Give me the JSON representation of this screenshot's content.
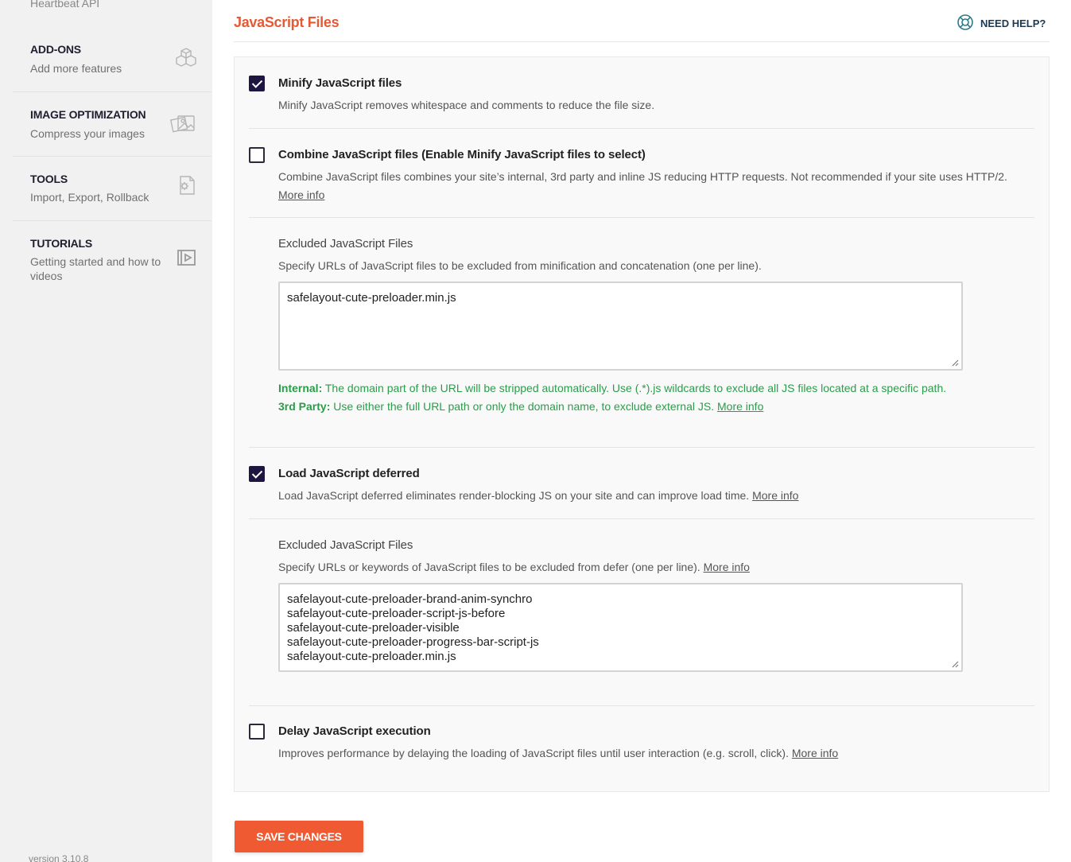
{
  "sidebar": {
    "top_item": "Heartbeat API",
    "items": [
      {
        "title": "ADD-ONS",
        "subtitle": "Add more features",
        "icon": "cubes-icon"
      },
      {
        "title": "IMAGE OPTIMIZATION",
        "subtitle": "Compress your images",
        "icon": "images-icon"
      },
      {
        "title": "TOOLS",
        "subtitle": "Import, Export, Rollback",
        "icon": "gear-file-icon"
      },
      {
        "title": "TUTORIALS",
        "subtitle": "Getting started and how to videos",
        "icon": "video-icon"
      }
    ],
    "version": "version 3.10.8"
  },
  "header": {
    "title": "JavaScript Files",
    "help_label": "NEED HELP?"
  },
  "options": {
    "minify": {
      "checked": true,
      "title": "Minify JavaScript files",
      "desc": "Minify JavaScript removes whitespace and comments to reduce the file size."
    },
    "combine": {
      "checked": false,
      "title": "Combine JavaScript files (Enable Minify JavaScript files to select)",
      "desc": "Combine JavaScript files combines your site’s internal, 3rd party and inline JS reducing HTTP requests. Not recommended if your site uses HTTP/2.",
      "link": "More info"
    },
    "excluded_minify": {
      "title": "Excluded JavaScript Files",
      "desc": "Specify URLs of JavaScript files to be excluded from minification and concatenation (one per line).",
      "value": "safelayout-cute-preloader.min.js",
      "note_internal_label": "Internal:",
      "note_internal_text": " The domain part of the URL will be stripped automatically. Use (.*).js wildcards to exclude all JS files located at a specific path.",
      "note_3rd_label": "3rd Party:",
      "note_3rd_text": " Use either the full URL path or only the domain name, to exclude external JS. ",
      "note_link": "More info"
    },
    "defer": {
      "checked": true,
      "title": "Load JavaScript deferred",
      "desc": "Load JavaScript deferred eliminates render-blocking JS on your site and can improve load time. ",
      "link": "More info"
    },
    "excluded_defer": {
      "title": "Excluded JavaScript Files",
      "desc": "Specify URLs or keywords of JavaScript files to be excluded from defer (one per line). ",
      "link": "More info",
      "lines": [
        "safelayout-cute-preloader-brand-anim-synchro",
        "safelayout-cute-preloader-script-js-before",
        "safelayout-cute-preloader-visible",
        "safelayout-cute-preloader-progress-bar-script-js",
        "safelayout-cute-preloader.min.js"
      ]
    },
    "delay": {
      "checked": false,
      "title": "Delay JavaScript execution",
      "desc": "Improves performance by delaying the loading of JavaScript files until user interaction (e.g. scroll, click). ",
      "link": "More info"
    }
  },
  "save_label": "SAVE CHANGES",
  "colors": {
    "accent": "#f05a33",
    "title": "#e45a35",
    "checkbox": "#1e1540",
    "note_green": "#2a9d4a"
  }
}
